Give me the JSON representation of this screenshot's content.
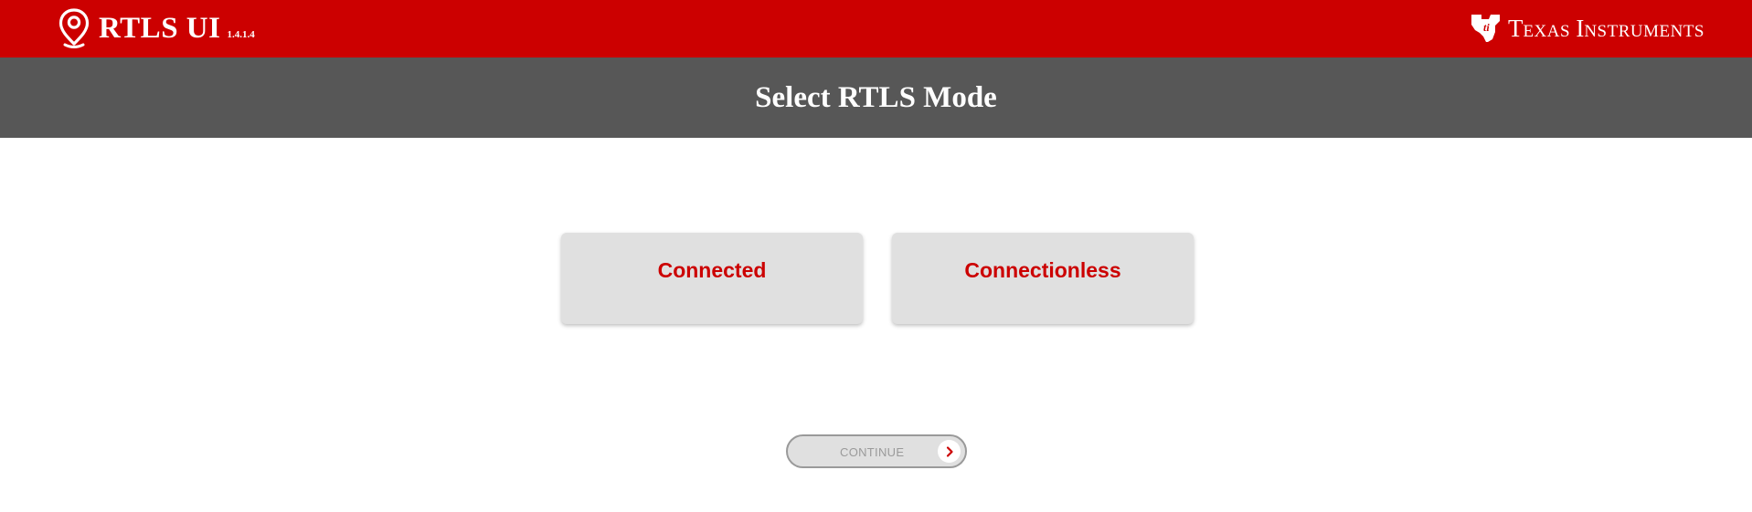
{
  "app": {
    "title": "RTLS UI",
    "version": "1.4.1.4",
    "logo_icon": "location-pin-icon",
    "vendor_logo_icon": "texas-instruments-logo-icon",
    "vendor_text_first": "T",
    "vendor_text_first_rest": "EXAS",
    "vendor_text_second": "I",
    "vendor_text_second_rest": "NSTRUMENTS"
  },
  "page": {
    "title": "Select RTLS Mode"
  },
  "modes": [
    {
      "label": "Connected"
    },
    {
      "label": "Connectionless"
    }
  ],
  "continue_button": {
    "label": "CONTINUE",
    "enabled": false,
    "icon": "chevron-right-icon"
  },
  "colors": {
    "brand_red": "#cc0000",
    "subheader_gray": "#575757",
    "card_gray": "#e0e0e0",
    "disabled_text": "#9a9a9a"
  }
}
